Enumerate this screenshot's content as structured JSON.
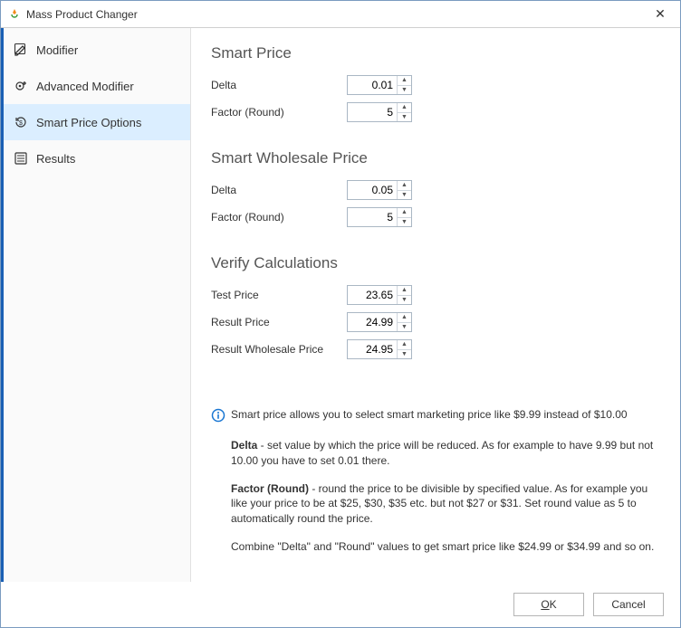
{
  "window": {
    "title": "Mass Product Changer"
  },
  "sidebar": {
    "items": [
      {
        "label": "Modifier"
      },
      {
        "label": "Advanced Modifier"
      },
      {
        "label": "Smart Price Options"
      },
      {
        "label": "Results"
      }
    ]
  },
  "sections": {
    "smartPrice": {
      "title": "Smart Price",
      "deltaLabel": "Delta",
      "delta": "0.01",
      "factorLabel": "Factor (Round)",
      "factor": "5"
    },
    "smartWholesale": {
      "title": "Smart Wholesale Price",
      "deltaLabel": "Delta",
      "delta": "0.05",
      "factorLabel": "Factor (Round)",
      "factor": "5"
    },
    "verify": {
      "title": "Verify Calculations",
      "testLabel": "Test Price",
      "test": "23.65",
      "resultLabel": "Result Price",
      "result": "24.99",
      "wholesaleLabel": "Result Wholesale Price",
      "wholesale": "24.95"
    }
  },
  "help": {
    "intro": "Smart price allows you to select smart marketing price like $9.99 instead of $10.00",
    "deltaBold": "Delta",
    "deltaText": " - set value by which the price will be reduced. As for example to have 9.99 but not 10.00 you have to set 0.01 there.",
    "factorBold": "Factor (Round)",
    "factorText": " - round the price to be divisible by specified value. As for example you like your price to be at $25, $30, $35 etc. but not $27 or $31. Set round value as 5 to automatically round the price.",
    "combine": "Combine \"Delta\" and \"Round\" values to get smart price like $24.99 or $34.99 and so on."
  },
  "buttons": {
    "ok": "OK",
    "cancel": "Cancel"
  }
}
